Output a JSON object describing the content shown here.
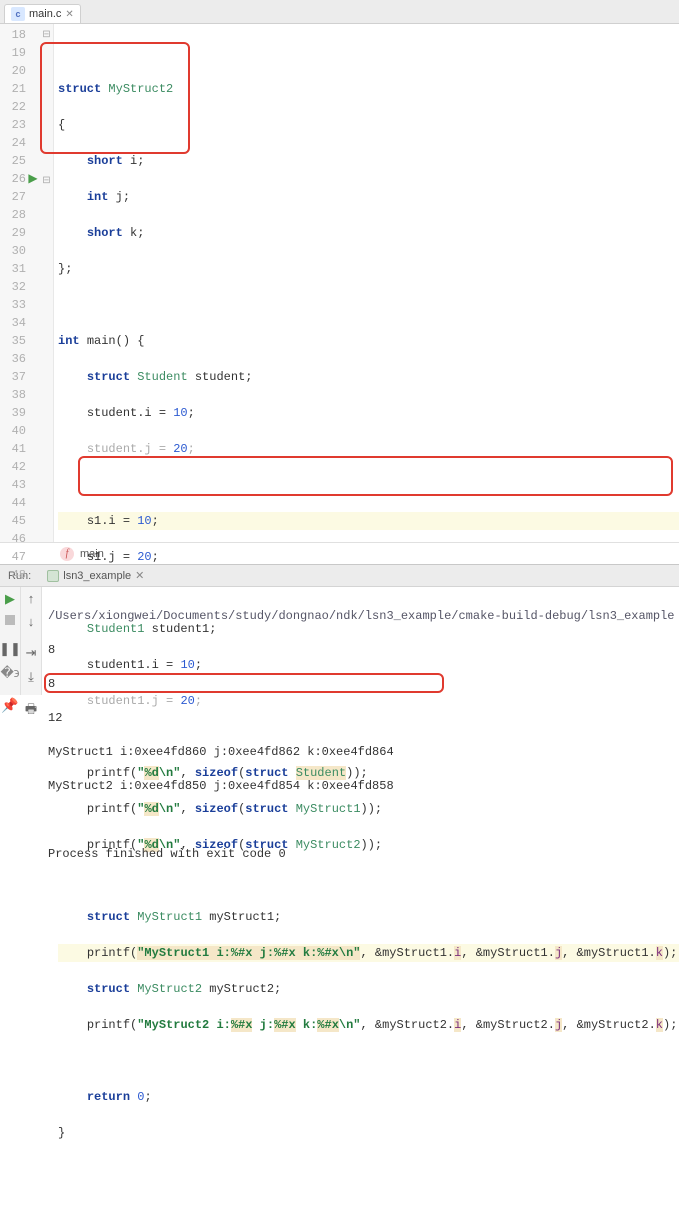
{
  "tabs": {
    "file": "main.c"
  },
  "gutter": {
    "start": 18,
    "lines": [
      "18",
      "19",
      "20",
      "21",
      "22",
      "23",
      "24",
      "25",
      "26",
      "27",
      "28",
      "29",
      "30",
      "31",
      "32",
      "33",
      "34",
      "35",
      "36",
      "37",
      "38",
      "39",
      "40",
      "41",
      "42",
      "43",
      "44",
      "45",
      "46",
      "47",
      "48"
    ]
  },
  "folds": {
    "26": "⊟",
    "18_indicator": "⊟"
  },
  "run_marker_line": "26",
  "code": {
    "l19_kw": "struct",
    "l19_type": "MyStruct2",
    "l20_brace": "{",
    "l21_kw": "short",
    "l21_id": "i;",
    "l22_kw": "int",
    "l22_id": "j;",
    "l23_kw": "short",
    "l23_id": "k;",
    "l24_close": "};",
    "l26_kw1": "int",
    "l26_fn": "main() {",
    "l27_kw": "struct",
    "l27_type": "Student",
    "l27_rest": " student;",
    "l28_txt": "student.i = ",
    "l28_num": "10",
    "l28_end": ";",
    "l29_txt": "student.j = ",
    "l29_num": "20",
    "l29_end": ";",
    "l31_txt": "s1.i = ",
    "l31_num": "10",
    "l31_end": ";",
    "l32_txt": "s1.j = ",
    "l32_num": "20",
    "l32_end": ";",
    "l34_type": "Student1",
    "l34_rest": " student1;",
    "l35_txt": "student1.i = ",
    "l35_num": "10",
    "l35_end": ";",
    "l36_txt": "student1.j = ",
    "l36_num": "20",
    "l36_end": ";",
    "l38_fn": "printf(",
    "l38_str1": "\"",
    "l38_fmt": "%d",
    "l38_str2": "\\n\"",
    "l38_mid": ", ",
    "l38_kw": "sizeof",
    "l38_p1": "(",
    "l38_skw": "struct",
    "l38_type": "Student",
    "l38_p2": "));",
    "l39_type": "MyStruct1",
    "l40_type": "MyStruct2",
    "l42_kw": "struct",
    "l42_type": "MyStruct1",
    "l42_rest": " myStruct1;",
    "l43_fn": "printf(",
    "l43_str": "\"MyStruct1 i:%#x j:%#x k:%#x\\n\"",
    "l43_mid": ", &myStruct1.",
    "l43_i": "i",
    "l43_mid2": ", &myStruct1.",
    "l43_j": "j",
    "l43_mid3": ", &myStruct1.",
    "l43_k": "k",
    "l43_end": ");",
    "l44_kw": "struct",
    "l44_type": "MyStruct2",
    "l44_rest": " myStruct2;",
    "l45_fn": "printf(",
    "l45_str": "\"MyStruct2 i:",
    "l45_f1": "%#x",
    "l45_s2": " j:",
    "l45_f2": "%#x",
    "l45_s3": " k:",
    "l45_f3": "%#x",
    "l45_s4": "\\n\"",
    "l45_mid": ", &myStruct2.",
    "l45_i": "i",
    "l45_mid2": ", &myStruct2.",
    "l45_j": "j",
    "l45_mid3": ", &myStruct2.",
    "l45_k": "k",
    "l45_end": ");",
    "l47_kw": "return",
    "l47_num": "0",
    "l47_end": ";",
    "l48_close": "}"
  },
  "breadcrumb": {
    "fn": "main"
  },
  "run": {
    "label": "Run:",
    "tab": "lsn3_example",
    "path": "/Users/xiongwei/Documents/study/dongnao/ndk/lsn3_example/cmake-build-debug/lsn3_example",
    "out1": "8",
    "out2": "8",
    "out3": "12",
    "out4": "MyStruct1 i:0xee4fd860 j:0xee4fd862 k:0xee4fd864",
    "out5": "MyStruct2 i:0xee4fd850 j:0xee4fd854 k:0xee4fd858",
    "exit": "Process finished with exit code 0"
  }
}
